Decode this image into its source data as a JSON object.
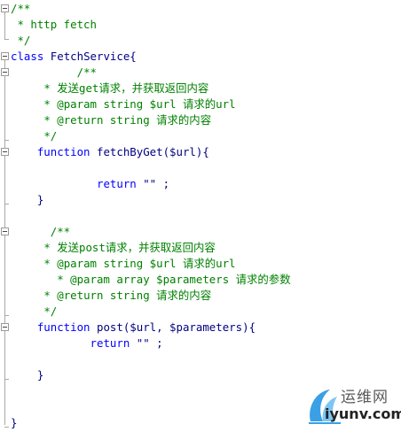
{
  "code_lines": [
    {
      "indent": "",
      "parts": [
        {
          "t": "/**",
          "c": "cm"
        }
      ]
    },
    {
      "indent": "",
      "parts": [
        {
          "t": " * http fetch",
          "c": "cm"
        }
      ]
    },
    {
      "indent": "",
      "parts": [
        {
          "t": " */",
          "c": "cm"
        }
      ]
    },
    {
      "indent": "",
      "parts": [
        {
          "t": "class",
          "c": "kw"
        },
        {
          "t": " FetchService{",
          "c": "tx"
        }
      ]
    },
    {
      "indent": "          ",
      "parts": [
        {
          "t": "/**",
          "c": "cm"
        }
      ]
    },
    {
      "indent": "     ",
      "parts": [
        {
          "t": "* 发送get请求，并获取返回内容",
          "c": "cm"
        }
      ]
    },
    {
      "indent": "     ",
      "parts": [
        {
          "t": "* @param string $url 请求的url",
          "c": "cm"
        }
      ]
    },
    {
      "indent": "     ",
      "parts": [
        {
          "t": "* @return string 请求的内容",
          "c": "cm"
        }
      ]
    },
    {
      "indent": "     ",
      "parts": [
        {
          "t": "*/",
          "c": "cm"
        }
      ]
    },
    {
      "indent": "    ",
      "parts": [
        {
          "t": "function",
          "c": "kw"
        },
        {
          "t": " fetchByGet($url){",
          "c": "tx"
        }
      ]
    },
    {
      "indent": "",
      "parts": [
        {
          "t": "",
          "c": "tx"
        }
      ]
    },
    {
      "indent": "             ",
      "parts": [
        {
          "t": "return",
          "c": "kw"
        },
        {
          "t": " \"\" ;",
          "c": "tx"
        }
      ]
    },
    {
      "indent": "    ",
      "parts": [
        {
          "t": "}",
          "c": "tx"
        }
      ]
    },
    {
      "indent": "",
      "parts": [
        {
          "t": "",
          "c": "tx"
        }
      ]
    },
    {
      "indent": "      ",
      "parts": [
        {
          "t": "/**",
          "c": "cm"
        }
      ]
    },
    {
      "indent": "     ",
      "parts": [
        {
          "t": "* 发送post请求，并获取返回内容",
          "c": "cm"
        }
      ]
    },
    {
      "indent": "     ",
      "parts": [
        {
          "t": "* @param string $url 请求的url",
          "c": "cm"
        }
      ]
    },
    {
      "indent": "       ",
      "parts": [
        {
          "t": "* @param array $parameters 请求的参数",
          "c": "cm"
        }
      ]
    },
    {
      "indent": "     ",
      "parts": [
        {
          "t": "* @return string 请求的内容",
          "c": "cm"
        }
      ]
    },
    {
      "indent": "     ",
      "parts": [
        {
          "t": "*/",
          "c": "cm"
        }
      ]
    },
    {
      "indent": "    ",
      "parts": [
        {
          "t": "function",
          "c": "kw"
        },
        {
          "t": " post($url, $parameters){",
          "c": "tx"
        }
      ]
    },
    {
      "indent": "            ",
      "parts": [
        {
          "t": "return",
          "c": "kw"
        },
        {
          "t": " \"\" ;",
          "c": "tx"
        }
      ]
    },
    {
      "indent": "",
      "parts": [
        {
          "t": "",
          "c": "tx"
        }
      ]
    },
    {
      "indent": "    ",
      "parts": [
        {
          "t": "}",
          "c": "tx"
        }
      ]
    },
    {
      "indent": "",
      "parts": [
        {
          "t": "",
          "c": "tx"
        }
      ]
    },
    {
      "indent": "",
      "parts": [
        {
          "t": "",
          "c": "tx"
        }
      ]
    },
    {
      "indent": "",
      "parts": [
        {
          "t": "}",
          "c": "tx"
        }
      ]
    }
  ],
  "watermark": {
    "brand_cn": "运维网",
    "brand_en": "iyunv.com",
    "logo_icon": "flame-arc-icon"
  },
  "colors": {
    "comment": "#008000",
    "keyword": "#0000ff",
    "text": "#000080",
    "background": "#ffffff"
  }
}
